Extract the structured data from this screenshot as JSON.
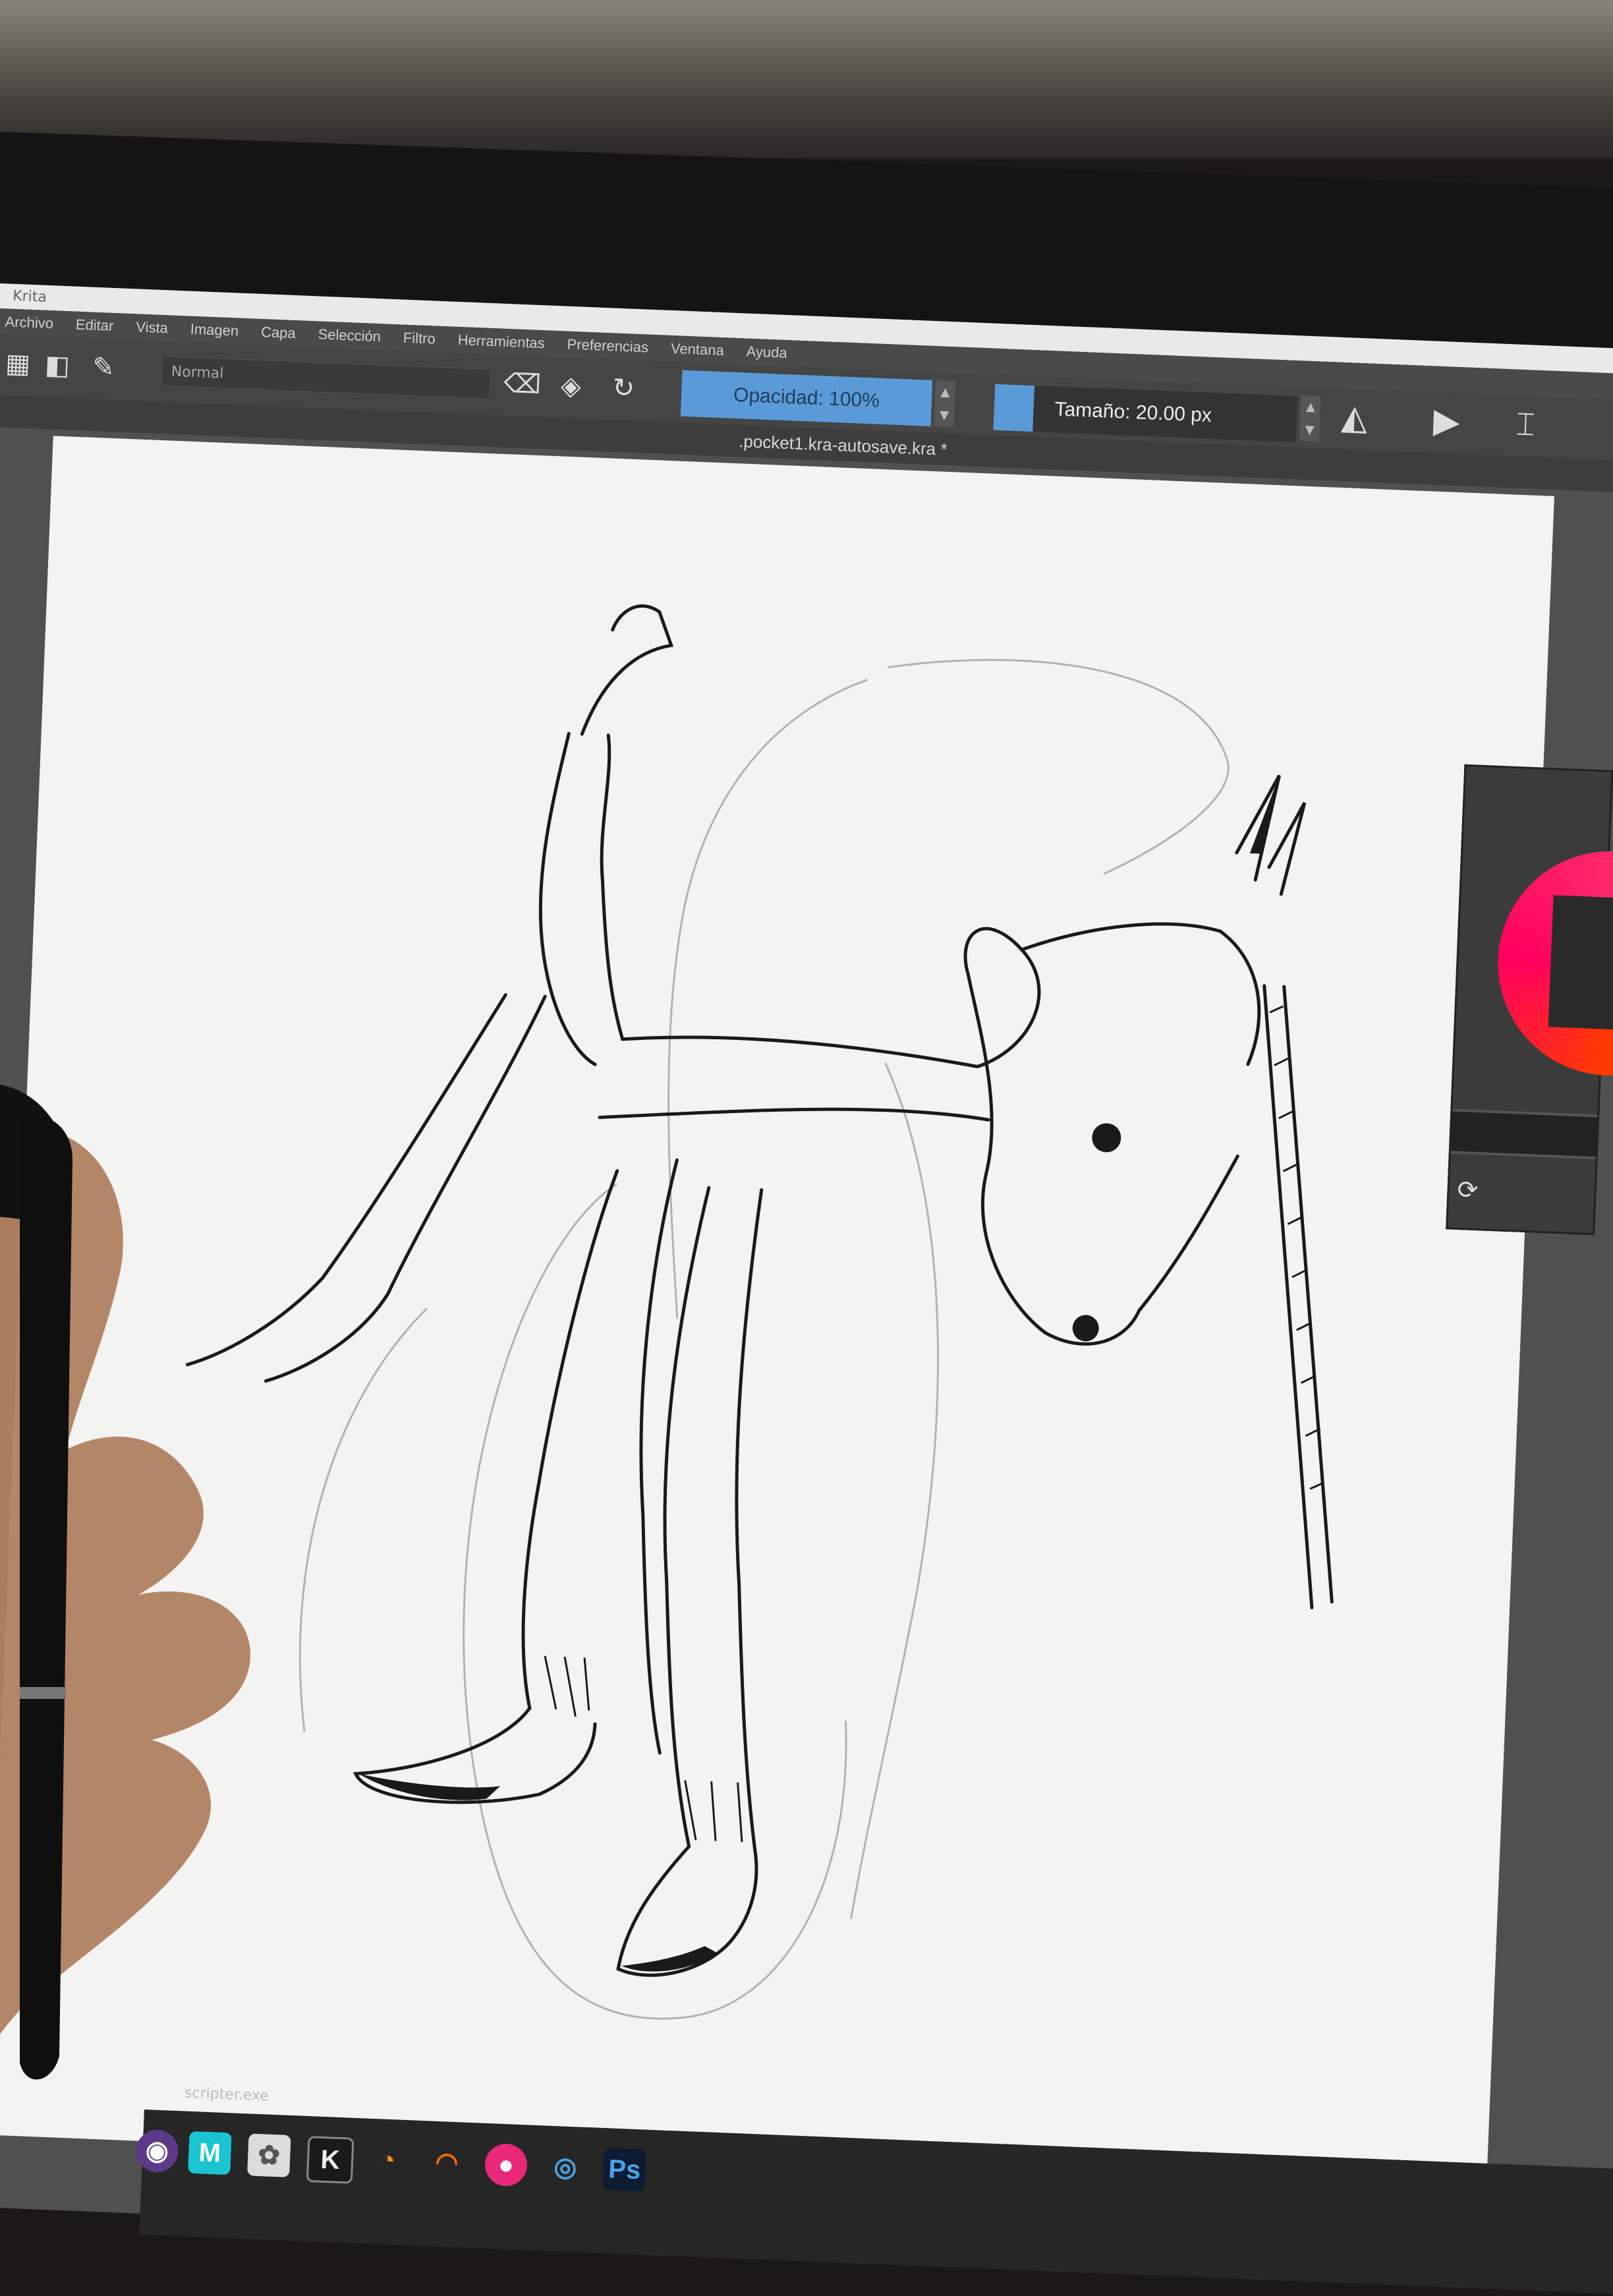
{
  "window": {
    "title": "Krita"
  },
  "menu": [
    "Archivo",
    "Editar",
    "Vista",
    "Imagen",
    "Capa",
    "Selección",
    "Filtro",
    "Herramientas",
    "Preferencias",
    "Ventana",
    "Ayuda"
  ],
  "toolbar": {
    "blend_mode": "Normal",
    "opacity_label": "Opacidad: 100%",
    "opacity_value": 100,
    "size_label": "Tamaño: 20.00 px",
    "size_fill_fraction": 0.13
  },
  "document": {
    "title": ".pocket1.kra-autosave.kra *"
  },
  "taskbar": {
    "file_label": "scripter.exe",
    "apps": [
      "krita-icon",
      "app-m-icon",
      "app-image-icon",
      "kdenlive-k-icon",
      "blender-icon",
      "ubisoft-icon",
      "osu-icon",
      "steam-icon",
      "photoshop-icon"
    ]
  },
  "colors": {
    "accent": "#5a9ad8",
    "canvas": "#f3f3f1",
    "ui_dark": "#3d3d3d"
  }
}
